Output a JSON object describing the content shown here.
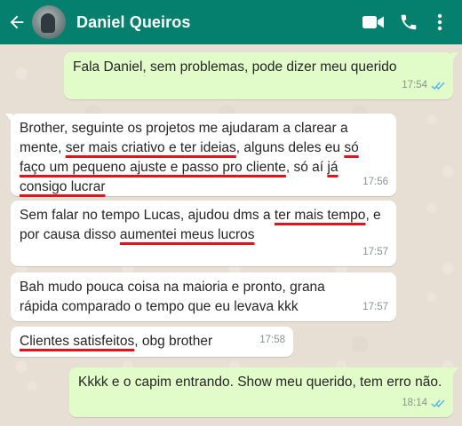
{
  "header": {
    "contact_name": "Daniel Queiros",
    "back_icon": "arrow-left-icon",
    "video_icon": "video-camera-icon",
    "call_icon": "phone-icon",
    "menu_icon": "more-vertical-icon",
    "background_color": "#06806e"
  },
  "chat": {
    "wallpaper_color": "#e8dfd4",
    "outgoing_color": "#e2fcc9",
    "incoming_color": "#ffffff",
    "highlight_color": "#e0141b",
    "read_check_color": "#4fb6ec"
  },
  "messages": [
    {
      "direction": "out",
      "text": "Fala Daniel, sem problemas, pode dizer meu querido",
      "time": "17:54",
      "status": "read"
    },
    {
      "direction": "in",
      "parts": [
        "Brother, seguinte os projetos me ajudaram a clarear a mente, ",
        "ser mais criativo e ter ideias",
        ", alguns deles eu ",
        "só faço um pequeno ajuste e passo pro cliente",
        ", só aí ",
        "já consigo lucrar"
      ],
      "time": "17:56"
    },
    {
      "direction": "in",
      "parts": [
        "Sem falar no tempo Lucas, ajudou dms a ",
        "ter mais tempo",
        ", e por causa disso ",
        "aumentei meus lucros"
      ],
      "time": "17:57"
    },
    {
      "direction": "in",
      "text": "Bah mudo pouca coisa na maioria e pronto, grana rápida comparado o tempo que eu levava kkk",
      "time": "17:57"
    },
    {
      "direction": "in",
      "parts": [
        "Clientes satisfeitos",
        ", obg brother"
      ],
      "time": "17:58"
    },
    {
      "direction": "out",
      "text": "Kkkk e o capim entrando. Show meu querido, tem erro não.",
      "time": "18:14",
      "status": "read"
    }
  ]
}
